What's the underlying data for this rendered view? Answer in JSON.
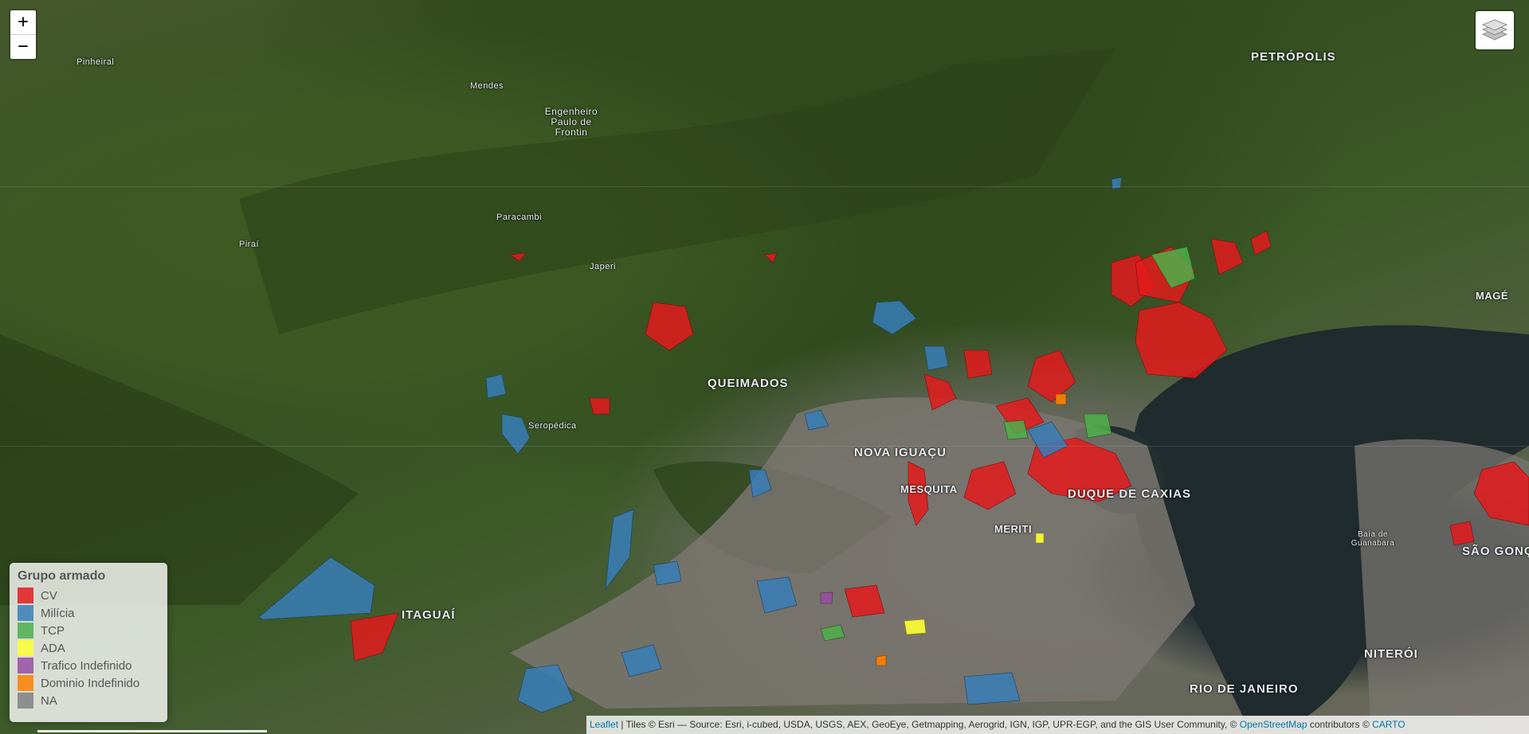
{
  "map": {
    "places": [
      {
        "id": "pinheiral",
        "label": "Pinheiral",
        "cls": "small"
      },
      {
        "id": "mendes",
        "label": "Mendes",
        "cls": "small"
      },
      {
        "id": "engenheiro",
        "label": "Engenheiro Paulo de Frontin",
        "cls": "multi"
      },
      {
        "id": "petropolis",
        "label": "PETRÓPOLIS",
        "cls": "big"
      },
      {
        "id": "pirai",
        "label": "Piraí",
        "cls": "small"
      },
      {
        "id": "paracambi",
        "label": "Paracambi",
        "cls": "small"
      },
      {
        "id": "japeri",
        "label": "Japeri",
        "cls": "small"
      },
      {
        "id": "mage",
        "label": "MAGÉ",
        "cls": ""
      },
      {
        "id": "queimados",
        "label": "QUEIMADOS",
        "cls": "big"
      },
      {
        "id": "seropedica",
        "label": "Seropédica",
        "cls": "small"
      },
      {
        "id": "novaiguacu",
        "label": "NOVA IGUAÇU",
        "cls": "big"
      },
      {
        "id": "mesquita",
        "label": "MESQUITA",
        "cls": ""
      },
      {
        "id": "duquecaxias",
        "label": "DUQUE DE CAXIAS",
        "cls": "big"
      },
      {
        "id": "meriti",
        "label": "MERITI",
        "cls": ""
      },
      {
        "id": "baia",
        "label": "Baía de Guanabara",
        "cls": "multi"
      },
      {
        "id": "saogoncalo",
        "label": "SÃO GONÇALO",
        "cls": "big"
      },
      {
        "id": "itaguai",
        "label": "ITAGUAÍ",
        "cls": "big"
      },
      {
        "id": "niteroi",
        "label": "NITERÓI",
        "cls": "big"
      },
      {
        "id": "riodejaneiro",
        "label": "RIO DE JANEIRO",
        "cls": "big"
      }
    ]
  },
  "zoom": {
    "in_label": "+",
    "out_label": "−"
  },
  "layers": {
    "icon": "layers-icon"
  },
  "legend": {
    "title": "Grupo armado",
    "items": [
      {
        "label": "CV",
        "color": "#e41a1c"
      },
      {
        "label": "Milícia",
        "color": "#377eb8"
      },
      {
        "label": "TCP",
        "color": "#4daf4a"
      },
      {
        "label": "ADA",
        "color": "#ffff33"
      },
      {
        "label": "Trafico Indefinido",
        "color": "#984ea3"
      },
      {
        "label": "Dominio Indefinido",
        "color": "#ff7f00"
      },
      {
        "label": "NA",
        "color": "#808080"
      }
    ]
  },
  "attribution": {
    "leaflet": "Leaflet",
    "tiles": " | Tiles © Esri — Source: Esri, i-cubed, USDA, USGS, AEX, GeoEye, Getmapping, Aerogrid, IGN, IGP, UPR-EGP, and the GIS User Community, © ",
    "osm": "OpenStreetMap",
    "contributors": " contributors © ",
    "carto": "CARTO"
  }
}
